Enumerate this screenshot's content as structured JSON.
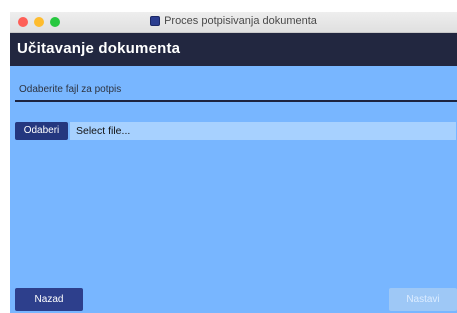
{
  "window": {
    "title": "Proces potpisivanja dokumenta",
    "icon": "app-icon",
    "background_color": "#78b6ff"
  },
  "header": {
    "title": "Učitavanje dokumenta",
    "background_color": "#222740"
  },
  "file_section": {
    "label": "Odaberite fajl za potpis",
    "choose_button_label": "Odaberi",
    "file_field_value": "Select file..."
  },
  "footer": {
    "back_label": "Nazad",
    "next_label": "Nastavi",
    "next_enabled": false
  }
}
